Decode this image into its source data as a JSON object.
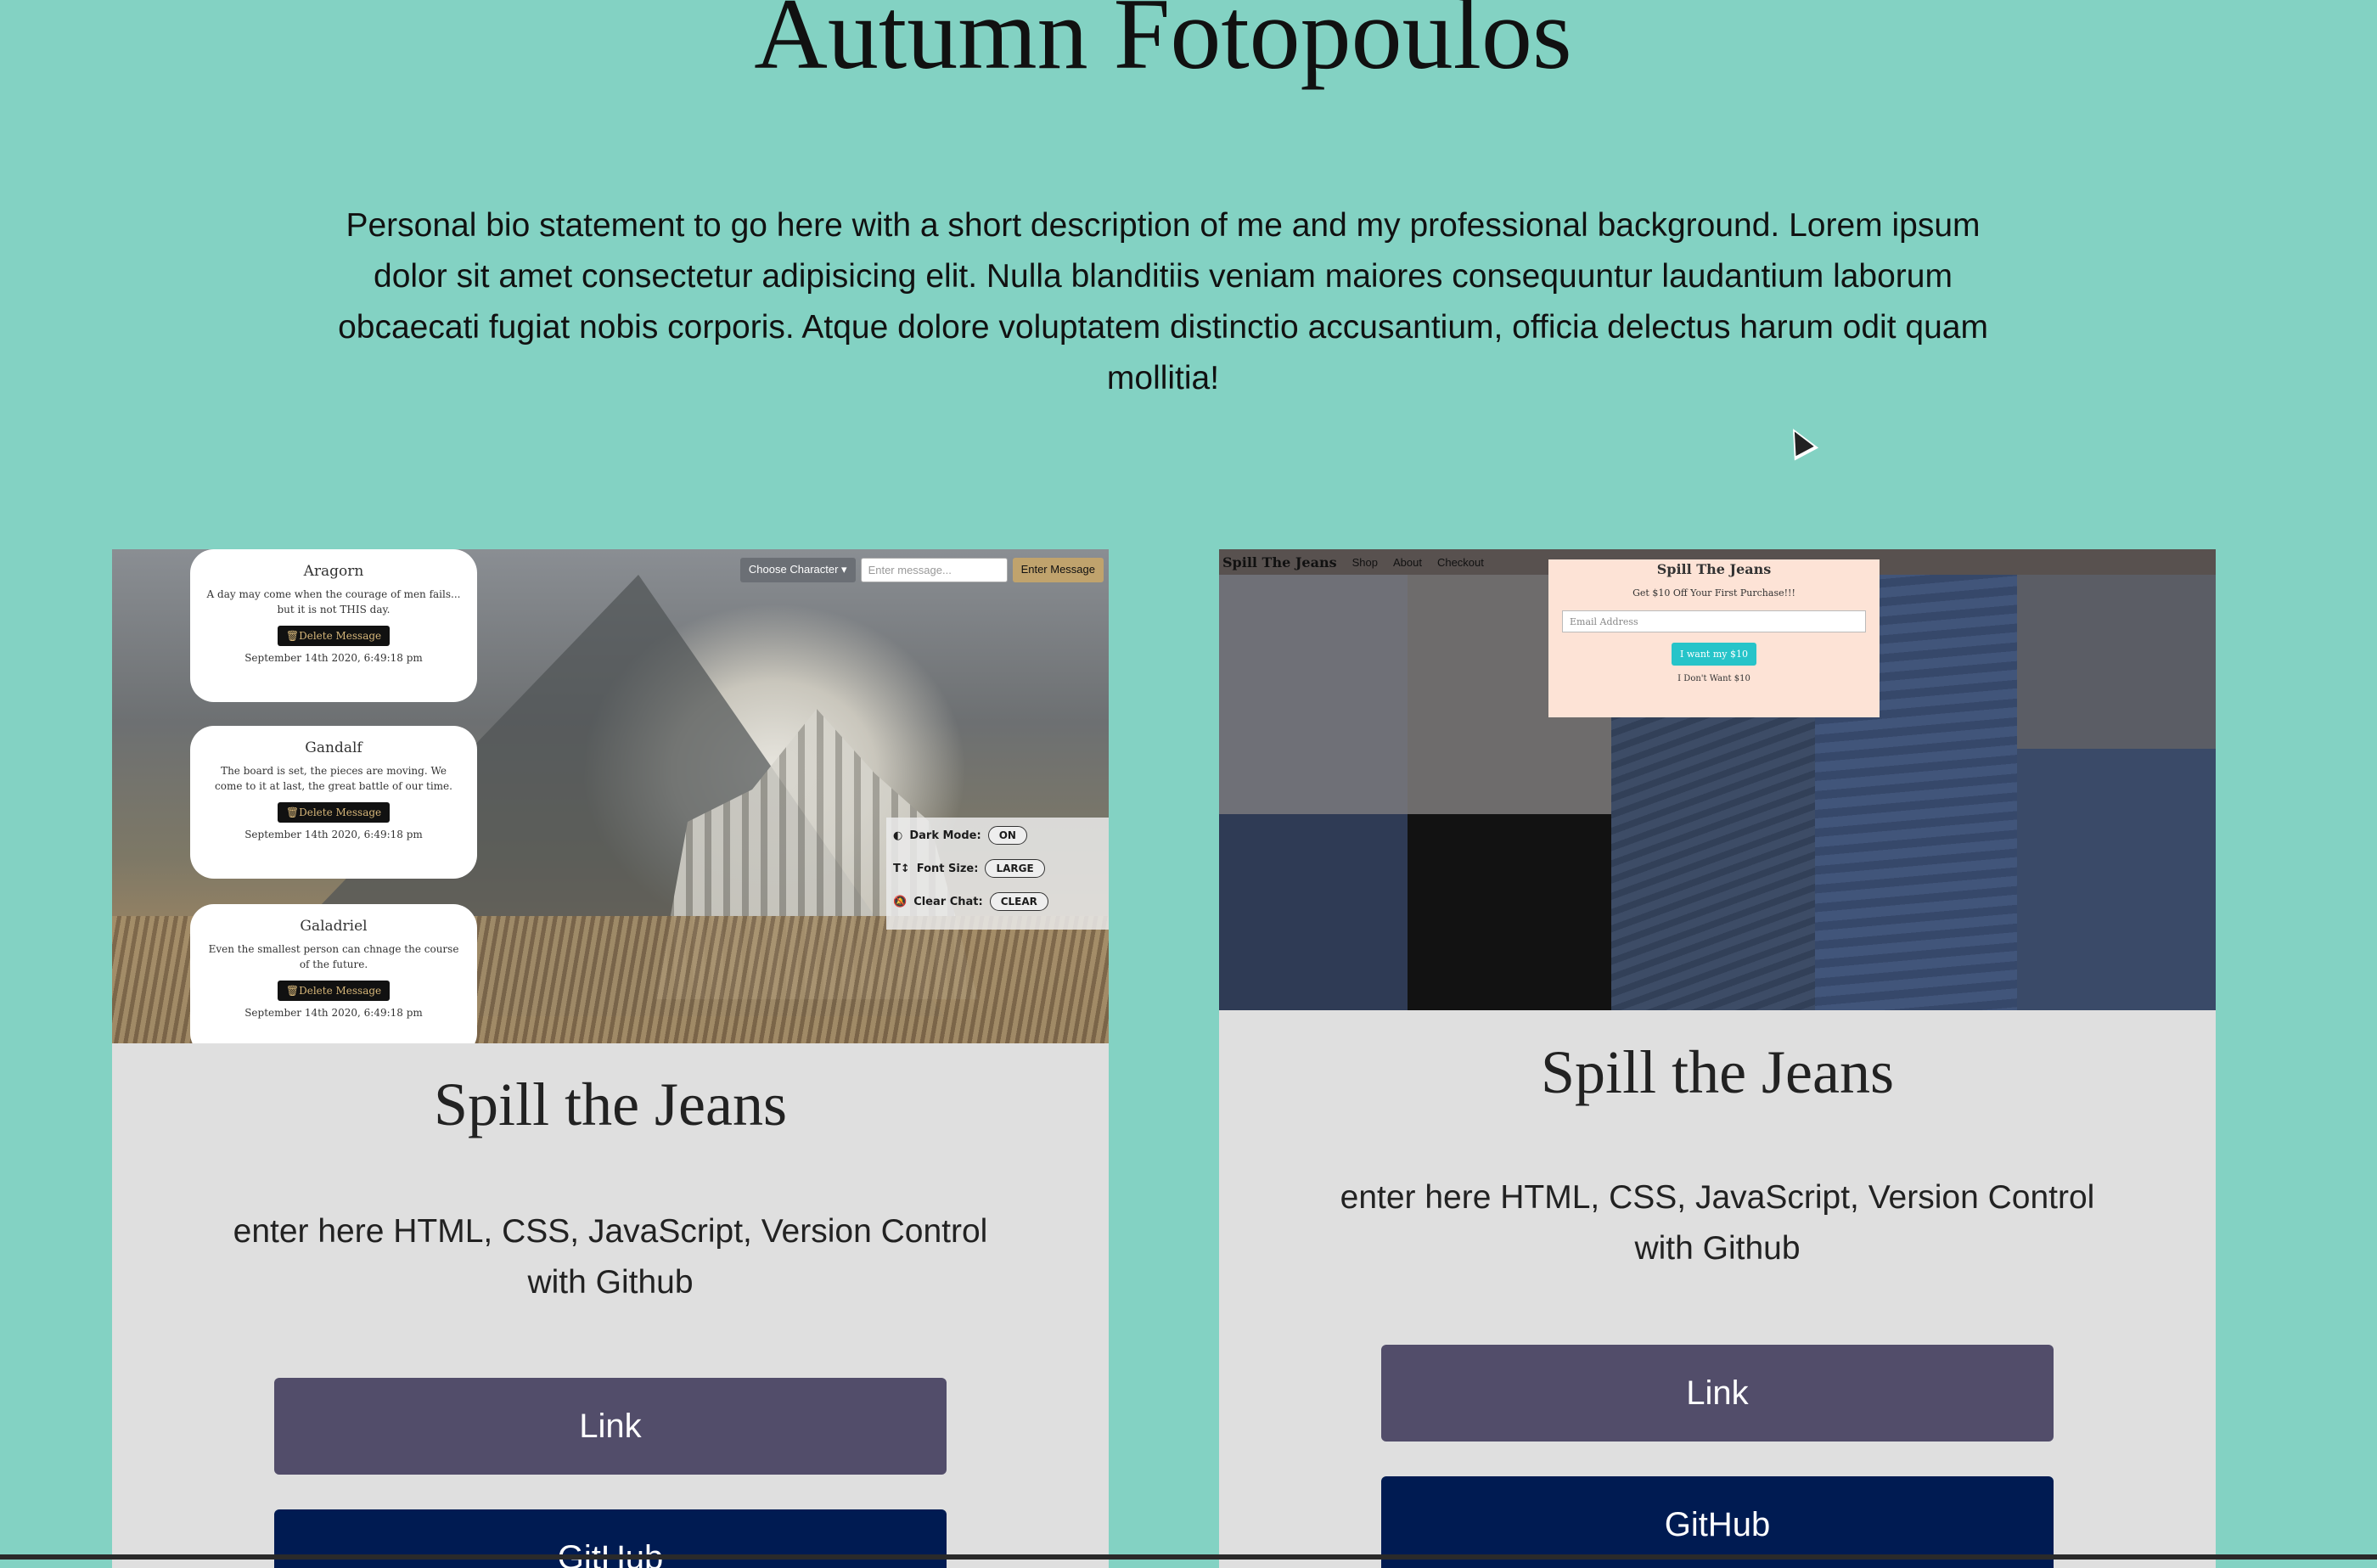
{
  "header": {
    "name": "Autumn Fotopoulos",
    "bio": "Personal bio statement to go here with a short description of me and my professional background. Lorem ipsum dolor sit amet consectetur adipisicing elit. Nulla blanditiis veniam maiores consequuntur laudantium laborum obcaecati fugiat nobis corporis. Atque dolore voluptatem distinctio accusantium, officia delectus harum odit quam mollitia!"
  },
  "projects": [
    {
      "title": "Spill the Jeans",
      "description": "enter here HTML, CSS, JavaScript, Version Control with Github",
      "link_label": "Link",
      "github_label": "GitHub",
      "screenshot": {
        "toolbar": {
          "choose": "Choose Character",
          "placeholder": "Enter message...",
          "enter": "Enter Message"
        },
        "messages": [
          {
            "name": "Aragorn",
            "text": "A day may come when the courage of men fails... but it is not THIS day.",
            "delete": "Delete Message",
            "time": "September 14th 2020, 6:49:18 pm"
          },
          {
            "name": "Gandalf",
            "text": "The board is set, the pieces are moving. We come to it at last, the great battle of our time.",
            "delete": "Delete Message",
            "time": "September 14th 2020, 6:49:18 pm"
          },
          {
            "name": "Galadriel",
            "text": "Even the smallest person can chnage the course of the future.",
            "delete": "Delete Message",
            "time": "September 14th 2020, 6:49:18 pm"
          }
        ],
        "settings": [
          {
            "label": "Dark Mode:",
            "value": "ON"
          },
          {
            "label": "Font Size:",
            "value": "LARGE"
          },
          {
            "label": "Clear Chat:",
            "value": "CLEAR"
          }
        ]
      }
    },
    {
      "title": "Spill the Jeans",
      "description": "enter here HTML, CSS, JavaScript, Version Control with Github",
      "link_label": "Link",
      "github_label": "GitHub",
      "screenshot": {
        "brand": "Spill The Jeans",
        "nav": [
          "Shop",
          "About",
          "Checkout"
        ],
        "modal": {
          "title": "Spill The Jeans",
          "subtitle": "Get $10 Off Your First Purchase!!!",
          "email_placeholder": "Email Address",
          "want": "I want my $10",
          "dont": "I Don't Want $10"
        }
      }
    }
  ]
}
